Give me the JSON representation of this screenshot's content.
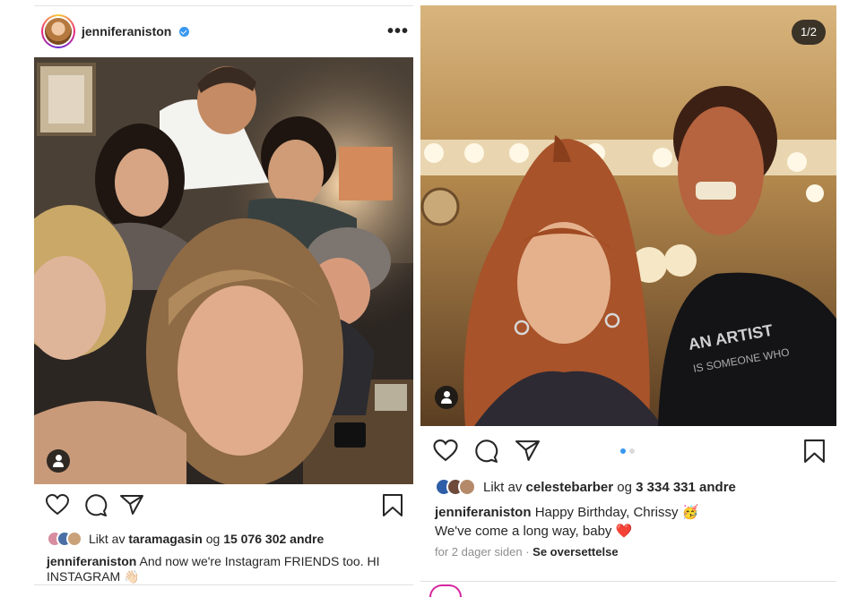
{
  "postA": {
    "username": "jenniferaniston",
    "more_icon": "•••",
    "likes": {
      "prefix": "Likt av",
      "liker": "taramagasin",
      "connector": "og",
      "count": "15 076 302 andre"
    },
    "caption": {
      "username": "jenniferaniston",
      "text": "And now we're Instagram FRIENDS too. HI INSTAGRAM",
      "emoji": "👋🏻"
    }
  },
  "postB": {
    "counter": "1/2",
    "likes": {
      "prefix": "Likt av",
      "liker": "celestebarber",
      "connector": "og",
      "count": "3 334 331 andre"
    },
    "caption": {
      "username": "jenniferaniston",
      "line1": "Happy Birthday, Chrissy",
      "emoji1": "🥳",
      "line2": "We've come a long way, baby",
      "emoji2": "❤️"
    },
    "timestamp": "for 2 dager siden",
    "separator": "·",
    "translate": "Se oversettelse",
    "carousel": {
      "index": 1,
      "total": 2
    }
  },
  "colors": {
    "accent": "#3897f0",
    "text": "#262626",
    "muted": "#8e8e8e",
    "heart": "#ed4956"
  },
  "icons": [
    "heart-icon",
    "comment-icon",
    "share-icon",
    "bookmark-icon",
    "user-tag-icon",
    "verified-badge-icon",
    "more-icon"
  ]
}
